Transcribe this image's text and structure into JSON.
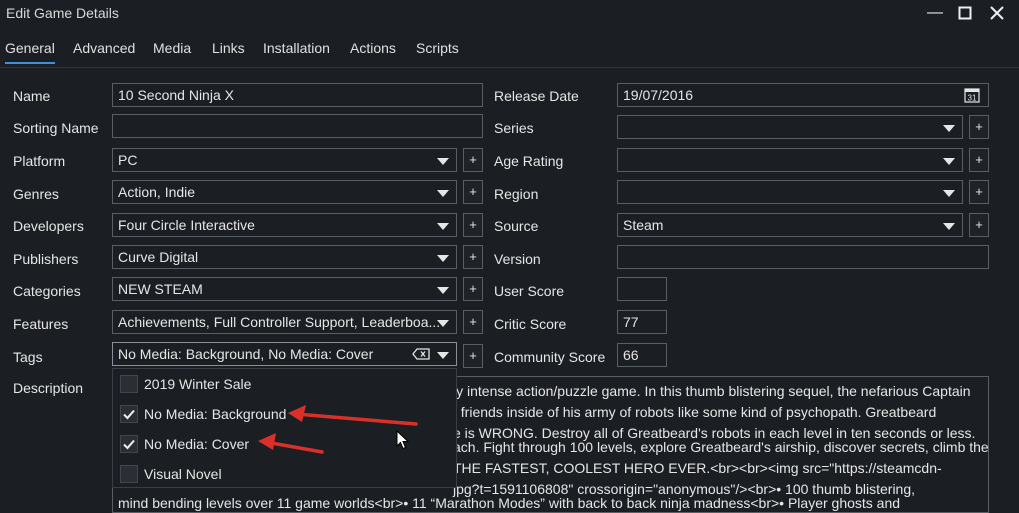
{
  "window": {
    "title": "Edit Game Details",
    "minimize_glyph": "—",
    "maximize_glyph": "☐",
    "close_glyph": "✕"
  },
  "tabs": [
    {
      "label": "General",
      "active": true
    },
    {
      "label": "Advanced"
    },
    {
      "label": "Media"
    },
    {
      "label": "Links"
    },
    {
      "label": "Installation"
    },
    {
      "label": "Actions"
    },
    {
      "label": "Scripts"
    }
  ],
  "left_fields": {
    "name": {
      "label": "Name",
      "value": "10 Second Ninja X"
    },
    "sorting_name": {
      "label": "Sorting Name",
      "value": ""
    },
    "platform": {
      "label": "Platform",
      "value": "PC"
    },
    "genres": {
      "label": "Genres",
      "value": "Action, Indie"
    },
    "developers": {
      "label": "Developers",
      "value": "Four Circle Interactive"
    },
    "publishers": {
      "label": "Publishers",
      "value": "Curve Digital"
    },
    "categories": {
      "label": "Categories",
      "value": "NEW STEAM"
    },
    "features": {
      "label": "Features",
      "value": "Achievements, Full Controller Support, Leaderboa..."
    },
    "tags": {
      "label": "Tags",
      "value": "No Media: Background, No Media: Cover"
    },
    "description": {
      "label": "Description"
    }
  },
  "right_fields": {
    "release_date": {
      "label": "Release Date",
      "value": "19/07/2016"
    },
    "series": {
      "label": "Series",
      "value": ""
    },
    "age_rating": {
      "label": "Age Rating",
      "value": ""
    },
    "region": {
      "label": "Region",
      "value": ""
    },
    "source": {
      "label": "Source",
      "value": "Steam"
    },
    "version": {
      "label": "Version",
      "value": ""
    },
    "user_score": {
      "label": "User Score",
      "value": ""
    },
    "critic_score": {
      "label": "Critic Score",
      "value": "77"
    },
    "community_score": {
      "label": "Community Score",
      "value": "66"
    }
  },
  "plus_label": "+",
  "calendar_day": "31",
  "tag_options": [
    {
      "label": "2019 Winter Sale",
      "checked": false
    },
    {
      "label": "No Media: Background",
      "checked": true
    },
    {
      "label": "No Media: Cover",
      "checked": true
    },
    {
      "label": "Visual Novel",
      "checked": false
    }
  ],
  "description_lines": [
    "ly intense action/puzzle game. In this thumb blistering sequel, the nefarious Captain",
    "t friends inside of his army of robots like some kind of psychopath. Greatbeard",
    "e is WRONG. Destroy all of Greatbeard's robots in each level in ten seconds or less.",
    "ach. Fight through 100 levels, explore Greatbeard's airship, discover secrets, climb the",
    "THE FASTEST, COOLEST HERO EVER.<br><br><img src=\"https://steamcdn-",
    "jpg?t=1591106808\" crossorigin=\"anonymous\"/><br>•       100 thumb blistering,",
    "mind bending levels over 11 game worlds<br>•       11 “Marathon Modes” with back to back ninja madness<br>•       Player ghosts and"
  ],
  "colors": {
    "background": "#1b1e23",
    "border": "#5a5f66",
    "accent": "#3f8fe0",
    "annotation_arrow": "#d9302a"
  }
}
